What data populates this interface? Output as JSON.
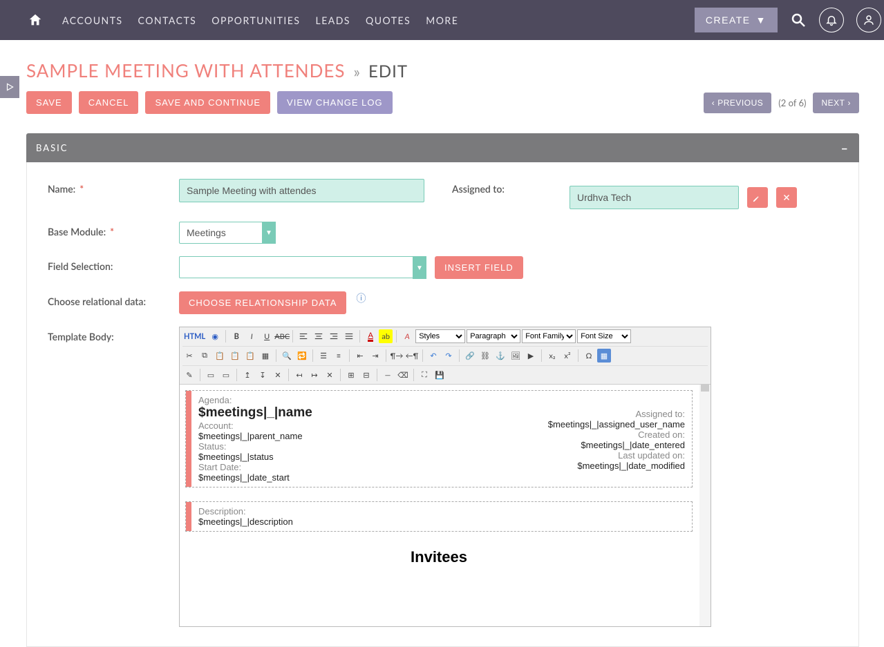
{
  "nav": {
    "items": [
      "ACCOUNTS",
      "CONTACTS",
      "OPPORTUNITIES",
      "LEADS",
      "QUOTES",
      "MORE"
    ],
    "create_label": "CREATE"
  },
  "page": {
    "title": "SAMPLE MEETING WITH ATTENDES",
    "mode": "EDIT"
  },
  "actions": {
    "save": "SAVE",
    "cancel": "CANCEL",
    "save_continue": "SAVE AND CONTINUE",
    "view_changelog": "VIEW CHANGE LOG",
    "previous": "PREVIOUS",
    "next": "NEXT",
    "page_indicator": "(2 of 6)"
  },
  "section": {
    "basic_title": "BASIC"
  },
  "form": {
    "name_label": "Name:",
    "name_value": "Sample Meeting with attendes",
    "assigned_label": "Assigned to:",
    "assigned_value": "Urdhva Tech",
    "base_module_label": "Base Module:",
    "base_module_value": "Meetings",
    "field_selection_label": "Field Selection:",
    "field_selection_value": "",
    "insert_field_button": "INSERT FIELD",
    "choose_rel_label": "Choose relational data:",
    "choose_rel_button": "CHOOSE RELATIONSHIP DATA",
    "template_body_label": "Template Body:"
  },
  "editor": {
    "html_label": "HTML",
    "dropdowns": {
      "styles": "Styles",
      "paragraph": "Paragraph",
      "font_family": "Font Family",
      "font_size": "Font Size"
    },
    "content": {
      "box1_left": [
        {
          "label": "Agenda:",
          "value": "$meetings|_|name",
          "big": true
        },
        {
          "label": "Account:",
          "value": "$meetings|_|parent_name"
        },
        {
          "label": "Status:",
          "value": "$meetings|_|status"
        },
        {
          "label": "Start Date:",
          "value": "$meetings|_|date_start"
        }
      ],
      "box1_right": [
        {
          "label": "Assigned to:",
          "value": "$meetings|_|assigned_user_name"
        },
        {
          "label": "Created on:",
          "value": "$meetings|_|date_entered"
        },
        {
          "label": "Last updated on:",
          "value": "$meetings|_|date_modified"
        }
      ],
      "box2": {
        "label": "Description:",
        "value": "$meetings|_|description"
      },
      "invitees_heading": "Invitees"
    }
  }
}
